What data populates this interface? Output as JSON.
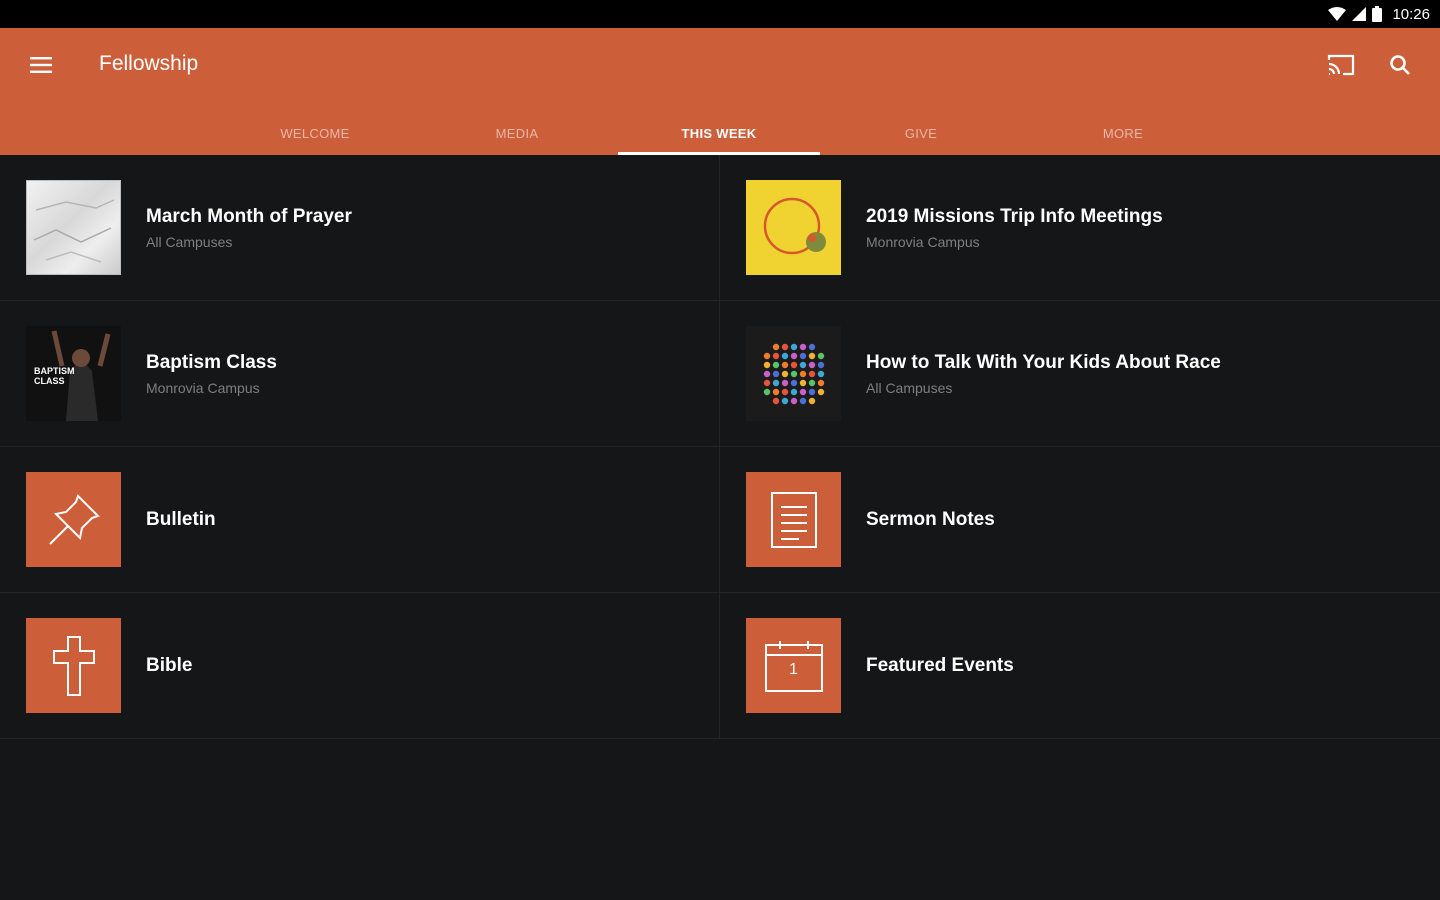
{
  "status_bar": {
    "time": "10:26"
  },
  "app_bar": {
    "title": "Fellowship"
  },
  "tabs": [
    {
      "label": "WELCOME",
      "active": false
    },
    {
      "label": "MEDIA",
      "active": false
    },
    {
      "label": "THIS WEEK",
      "active": true
    },
    {
      "label": "GIVE",
      "active": false
    },
    {
      "label": "MORE",
      "active": false
    }
  ],
  "items": [
    {
      "title": "March Month of Prayer",
      "subtitle": "All Campuses"
    },
    {
      "title": "2019 Missions Trip Info Meetings",
      "subtitle": "Monrovia Campus"
    },
    {
      "title": "Baptism Class",
      "subtitle": "Monrovia Campus",
      "thumb_text": "BAPTISM CLASS"
    },
    {
      "title": "How to Talk With Your Kids About Race",
      "subtitle": "All Campuses"
    },
    {
      "title": "Bulletin",
      "icon": "pushpin-icon"
    },
    {
      "title": "Sermon Notes",
      "icon": "document-icon"
    },
    {
      "title": "Bible",
      "icon": "cross-icon"
    },
    {
      "title": "Featured Events",
      "icon": "calendar-icon",
      "calendar_day": "1"
    }
  ],
  "colors": {
    "accent": "#cd5e3a",
    "background": "#151617",
    "subtitle": "#7d7f81"
  }
}
